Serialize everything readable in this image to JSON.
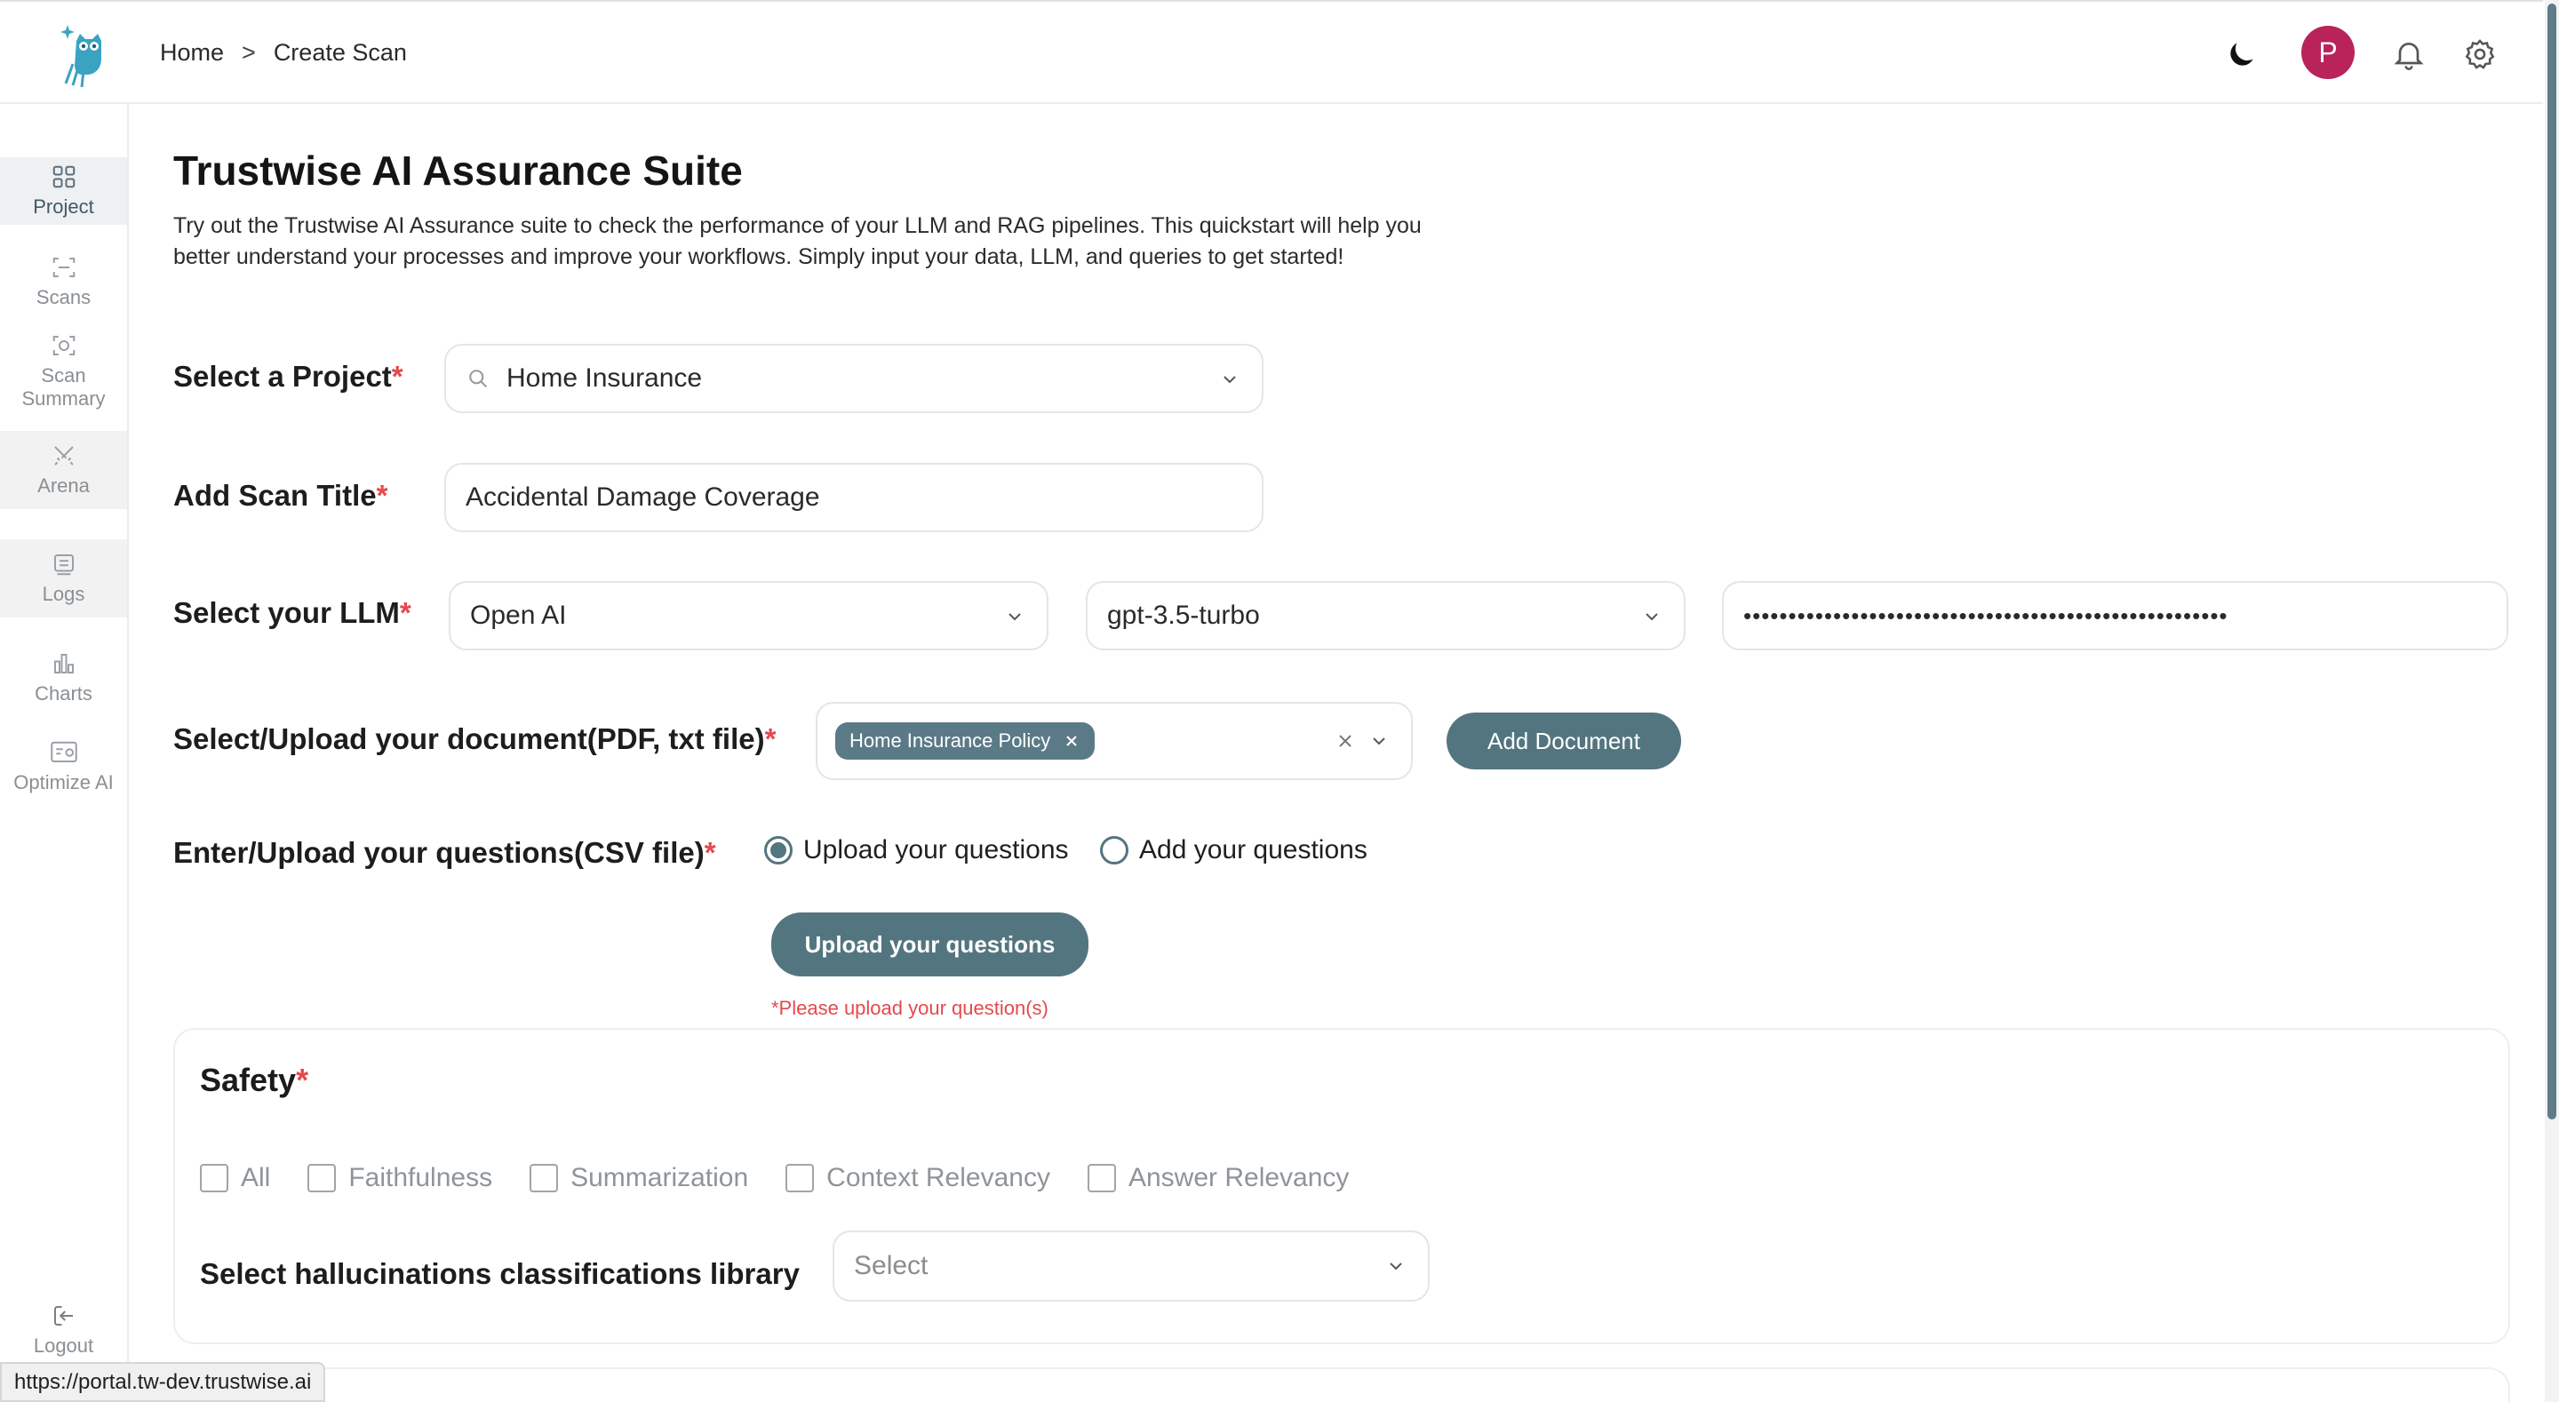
{
  "header": {
    "breadcrumb": [
      "Home",
      "Create Scan"
    ],
    "breadcrumb_separator": ">",
    "avatar_initial": "P",
    "icons": [
      "moon-icon",
      "bell-icon",
      "gear-icon"
    ]
  },
  "sidebar": {
    "items": [
      {
        "label": "Project",
        "icon": "grid-icon",
        "active": true
      },
      {
        "label": "Scans",
        "icon": "scan-icon"
      },
      {
        "label": "Scan Summary",
        "icon": "scan-summary-icon"
      },
      {
        "label": "Arena",
        "icon": "swords-icon"
      },
      {
        "label": "Logs",
        "icon": "logs-icon"
      },
      {
        "label": "Charts",
        "icon": "bar-chart-icon"
      },
      {
        "label": "Optimize AI",
        "icon": "optimize-icon"
      }
    ],
    "logout_label": "Logout"
  },
  "main": {
    "title": "Trustwise AI Assurance Suite",
    "description": "Try out the Trustwise AI Assurance suite to check the performance of your LLM and RAG pipelines. This quickstart will help you better understand your processes and improve your workflows. Simply input your data, LLM, and queries to get started!",
    "project": {
      "label": "Select a Project",
      "value": "Home Insurance"
    },
    "scan_title": {
      "label": "Add Scan Title",
      "value": "Accidental Damage Coverage"
    },
    "llm": {
      "label": "Select your LLM",
      "provider": "Open AI",
      "model": "gpt-3.5-turbo",
      "api_key_masked": "••••••••••••••••••••••••••••••••••••••••••••••••••••••"
    },
    "document": {
      "label": "Select/Upload your document(PDF, txt file)",
      "selected_tag": "Home Insurance Policy",
      "add_button": "Add Document"
    },
    "questions": {
      "label": "Enter/Upload your questions(CSV file)",
      "options": [
        "Upload your questions",
        "Add your questions"
      ],
      "selected": "Upload your questions",
      "upload_button": "Upload your questions",
      "warning": "*Please upload your question(s)"
    },
    "required_mark": "*",
    "safety": {
      "title": "Safety",
      "checkboxes": [
        "All",
        "Faithfulness",
        "Summarization",
        "Context Relevancy",
        "Answer Relevancy"
      ],
      "library_label": "Select hallucinations classifications library",
      "library_placeholder": "Select"
    }
  },
  "status_bar": {
    "url": "https://portal.tw-dev.trustwise.ai"
  },
  "colors": {
    "accent": "#537580",
    "required": "#e5484d",
    "avatar": "#b8245a"
  }
}
